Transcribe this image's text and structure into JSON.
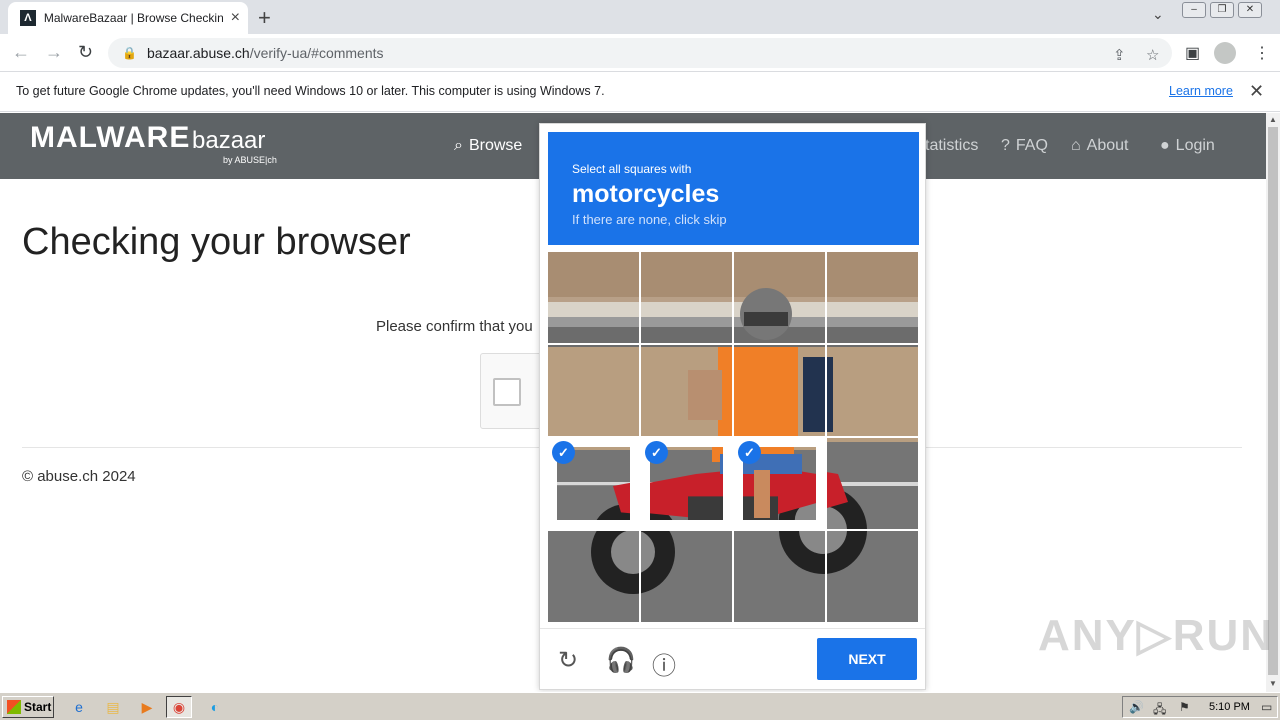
{
  "browser": {
    "tab_title": "MalwareBazaar | Browse Checking y",
    "url_host": "bazaar.abuse.ch",
    "url_path": "/verify-ua/#comments",
    "infobar_text": "To get future Google Chrome updates, you'll need Windows 10 or later. This computer is using Windows 7.",
    "infobar_link": "Learn more"
  },
  "site": {
    "logo_main": "MALWARE",
    "logo_sub": "bazaar",
    "logo_by": "by ABUSE|ch",
    "nav": [
      {
        "icon": "search-icon",
        "label": "Browse"
      },
      {
        "icon": "chart-icon",
        "label": "tatistics"
      },
      {
        "icon": "question-icon",
        "label": "FAQ"
      },
      {
        "icon": "building-icon",
        "label": "About"
      },
      {
        "icon": "user-icon",
        "label": "Login"
      }
    ],
    "heading": "Checking your browser",
    "confirm_text": "Please confirm that you",
    "footer": "© abuse.ch 2024"
  },
  "challenge": {
    "prompt": "Select all squares with",
    "target": "motorcycles",
    "skip_hint": "If there are none, click skip",
    "selected_cells": [
      8,
      9,
      10
    ],
    "next_label": "NEXT"
  },
  "taskbar": {
    "start_label": "Start",
    "clock": "5:10 PM"
  },
  "watermark": "ANY▷RUN",
  "colors": {
    "accent": "#1a73e8",
    "site_header": "#5e6366"
  }
}
